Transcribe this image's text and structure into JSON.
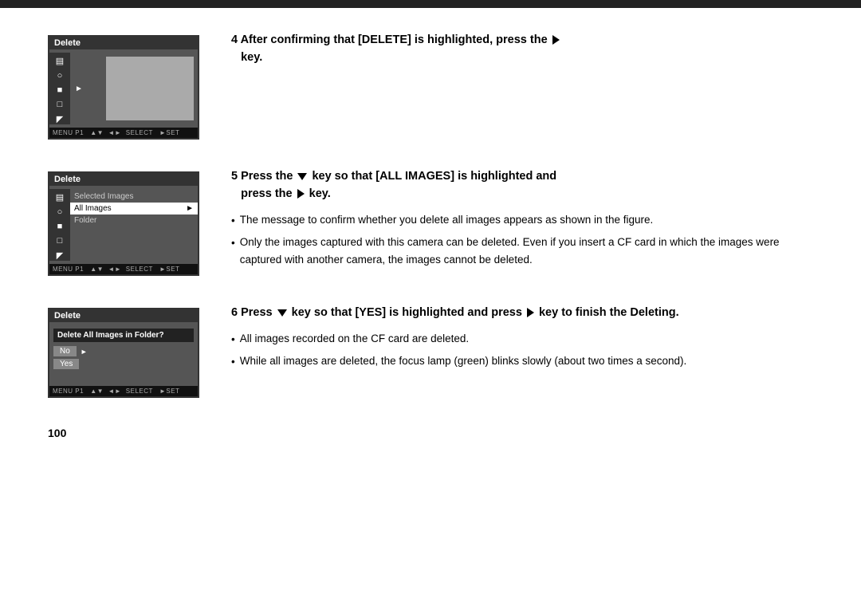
{
  "topBar": {},
  "steps": [
    {
      "id": "step4",
      "number": "4",
      "heading": "After confirming that [DELETE] is highlighted, press the",
      "heading2": "key.",
      "bullets": [],
      "screen": {
        "title": "Delete",
        "type": "icon-menu",
        "footer": "MENU P1   ▲▼  ◄►  SELECT   ► SET"
      }
    },
    {
      "id": "step5",
      "number": "5",
      "heading_pre": "Press the",
      "heading_mid": "key so that [ALL IMAGES] is highlighted and",
      "heading_post": "press the",
      "heading_end": "key.",
      "bullets": [
        "The message to confirm whether you delete all images appears as shown in the figure.",
        "Only the images captured with this camera can be deleted. Even if you insert a CF card in which the images were captured with another camera, the images cannot be deleted."
      ],
      "screen": {
        "title": "Delete",
        "type": "list",
        "items": [
          {
            "label": "Selected Images",
            "selected": false,
            "hasArrow": false
          },
          {
            "label": "All Images",
            "selected": true,
            "hasArrow": true
          },
          {
            "label": "Folder",
            "selected": false,
            "hasArrow": false
          }
        ],
        "footer": "MENU P1   ▲▼  ◄►  SELECT   ► SET"
      }
    },
    {
      "id": "step6",
      "number": "6",
      "heading_pre": "Press",
      "heading_mid": "key so that [YES] is highlighted and press",
      "heading_end": "key to finish the Deleting.",
      "bullets": [
        "All images recorded on the CF card are deleted.",
        "While all images are deleted, the focus lamp (green) blinks slowly (about two times a second)."
      ],
      "screen": {
        "title": "Delete",
        "type": "dialog",
        "question": "Delete All Images in Folder?",
        "options": [
          "No",
          "Yes"
        ],
        "footer": "MENU P1   ▲▼  ◄►  SELECT   ► SET"
      }
    }
  ],
  "pageNumber": "100",
  "icons": {
    "camera": "📷",
    "magnify": "🔍",
    "image": "🖼",
    "print": "🖨",
    "folder": "📁"
  }
}
